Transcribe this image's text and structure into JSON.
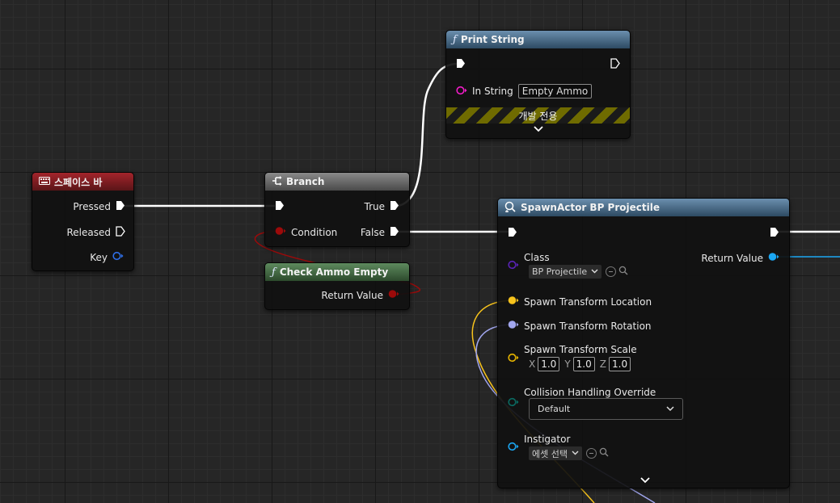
{
  "nodes": {
    "spacebar": {
      "title": "스페이스 바",
      "icon": "keyboard-icon",
      "pins": {
        "pressed": "Pressed",
        "released": "Released",
        "key": "Key"
      }
    },
    "branch": {
      "title": "Branch",
      "icon": "branch-icon",
      "pins": {
        "condition": "Condition",
        "true": "True",
        "false": "False"
      }
    },
    "check_ammo": {
      "title": "Check Ammo Empty",
      "icon": "function-icon",
      "pins": {
        "return_value": "Return Value"
      }
    },
    "print_string": {
      "title": "Print String",
      "icon": "function-icon",
      "pins": {
        "in_string": "In String"
      },
      "in_string_value": "Empty Ammo",
      "dev_only_label": "개발 전용"
    },
    "spawn_actor": {
      "title": "SpawnActor BP Projectile",
      "icon": "spawn-actor-icon",
      "pins": {
        "class": "Class",
        "return_value": "Return Value",
        "location": "Spawn Transform Location",
        "rotation": "Spawn Transform Rotation",
        "scale": "Spawn Transform Scale",
        "collision": "Collision Handling Override",
        "instigator": "Instigator"
      },
      "class_value": "BP Projectile",
      "scale": {
        "x_label": "X",
        "x": "1.0",
        "y_label": "Y",
        "y": "1.0",
        "z_label": "Z",
        "z": "1.0"
      },
      "collision_value": "Default",
      "instigator_value": "에셋 선택"
    }
  },
  "colors": {
    "exec": "#ffffff",
    "boolean": "#9c0a0a",
    "string": "#f31cc9",
    "class": "#5a23b8",
    "vector": "#f7c31c",
    "rotator": "#a1a6ee",
    "transform_scale": "#e7b500",
    "enum": "#0a6b62",
    "object": "#1ba7f3",
    "key_struct": "#2f6fe8"
  }
}
